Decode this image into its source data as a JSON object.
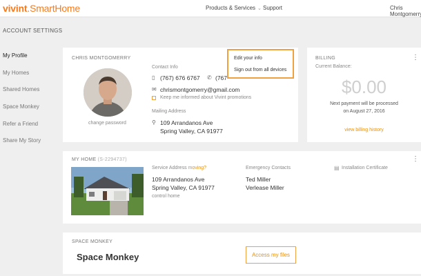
{
  "brand": {
    "name": "vivint",
    "suffix": ".SmartHome"
  },
  "nav": {
    "products": "Products & Services",
    "support": "Support",
    "user": "Chris Montgomerry"
  },
  "page": {
    "title": "ACCOUNT SETTINGS"
  },
  "sidebar": {
    "items": [
      {
        "label": "My Profile"
      },
      {
        "label": "My Homes"
      },
      {
        "label": "Shared Homes"
      },
      {
        "label": "Space Monkey"
      },
      {
        "label": "Refer a Friend"
      },
      {
        "label": "Share My Story"
      }
    ]
  },
  "profile": {
    "name": "CHRIS MONTGOMERRY",
    "change_password": "change password",
    "contact_label": "Contact Info",
    "phone1": "(767) 676 6767",
    "phone2": "(767",
    "email": "chrismontgomerry@gmail.com",
    "promo": "Keep me informed about Vivint promotions",
    "mailing_label": "Mailing Address",
    "address1": "109 Arrandanos Ave",
    "address2": "Spring Valley, CA 91977",
    "menu": {
      "edit": "Edit your info",
      "signout": "Sign out from all devices"
    }
  },
  "billing": {
    "label": "BILLING",
    "balance_label": "Current Balance:",
    "amount": "$0.00",
    "next_payment": "Next payment will be processed",
    "date": "on August 27, 2016",
    "history_link": "view billing history"
  },
  "home": {
    "label": "MY HOME",
    "id": "(S-2294737)",
    "service_label": "Service Address",
    "moving": "moving?",
    "address1": "109 Arrandanos Ave",
    "address2": "Spring Valley, CA 91977",
    "control": "control home",
    "emergency_label": "Emergency Contacts",
    "contact1": "Ted Miller",
    "contact2": "Verlease Miller",
    "certificate": "Installation Certificate"
  },
  "space_monkey": {
    "label": "SPACE MONKEY",
    "title": "Space Monkey",
    "button": "Access my files"
  },
  "colors": {
    "accent": "#f47b20",
    "link": "#e8900c",
    "bg": "#efefef"
  }
}
